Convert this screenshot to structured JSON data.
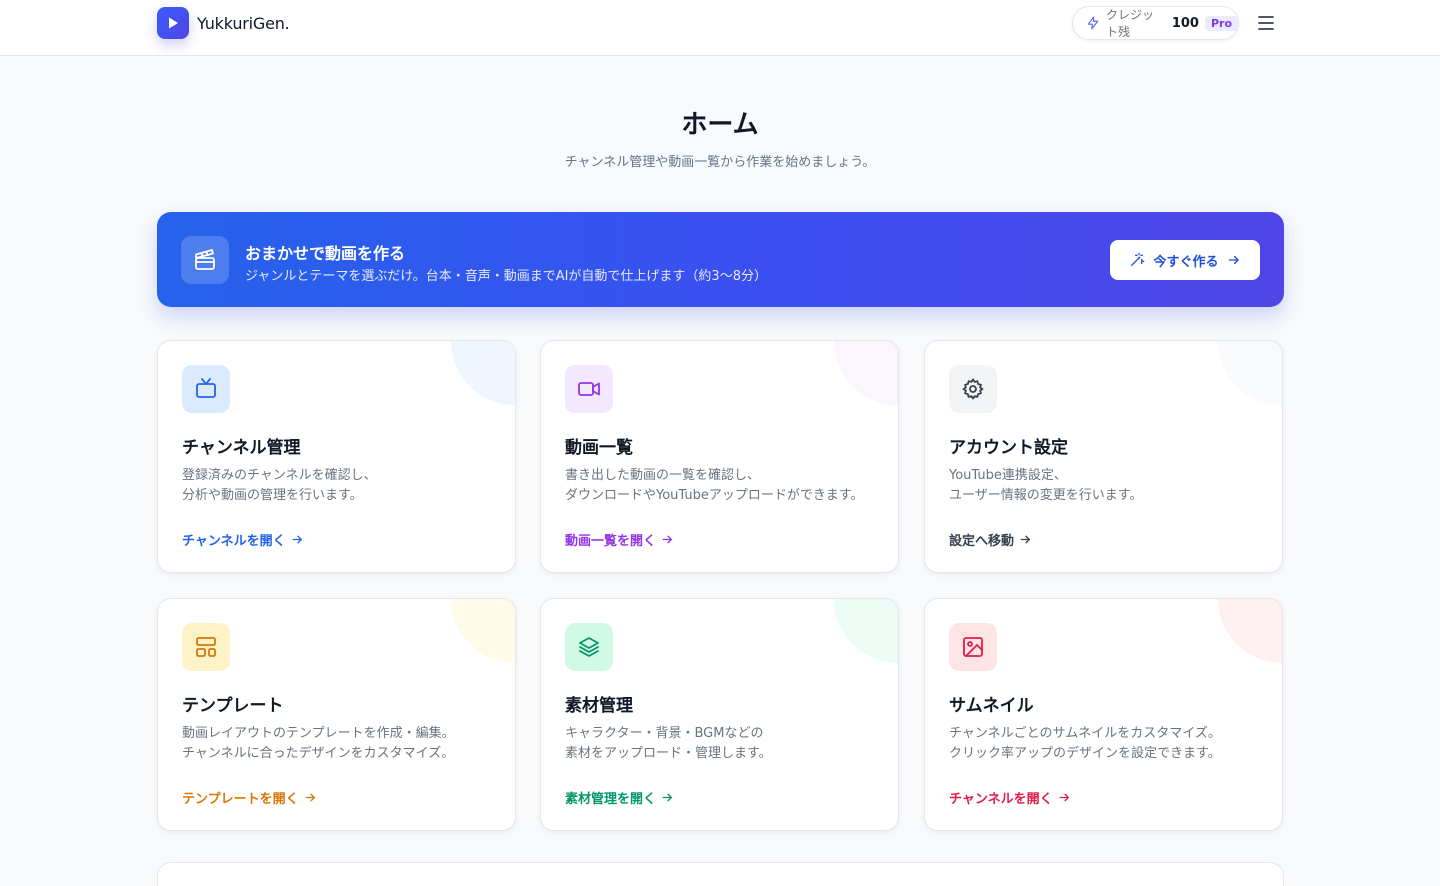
{
  "header": {
    "logo_text": "YukkuriGen.",
    "credit_label": "クレジット残",
    "credit_value": "100",
    "plan_badge": "Pro"
  },
  "page": {
    "title": "ホーム",
    "subtitle": "チャンネル管理や動画一覧から作業を始めましょう。"
  },
  "banner": {
    "title": "おまかせで動画を作る",
    "description": "ジャンルとテーマを選ぶだけ。台本・音声・動画までAIが自動で仕上げます（約3〜8分）",
    "button_label": "今すぐ作る"
  },
  "cards": [
    {
      "title": "チャンネル管理",
      "desc_line1": "登録済みのチャンネルを確認し、",
      "desc_line2": "分析や動画の管理を行います。",
      "link": "チャンネルを開く",
      "icon": "tv-icon",
      "accent": "#2563eb",
      "icon_bg": "#dbeafe",
      "deco": "#eff6ff"
    },
    {
      "title": "動画一覧",
      "desc_line1": "書き出した動画の一覧を確認し、",
      "desc_line2": "ダウンロードやYouTubeアップロードができます。",
      "link": "動画一覧を開く",
      "icon": "video-camera-icon",
      "accent": "#9333ea",
      "icon_bg": "#f3e8ff",
      "deco": "#faf5ff"
    },
    {
      "title": "アカウント設定",
      "desc_line1": "YouTube連携設定、",
      "desc_line2": "ユーザー情報の変更を行います。",
      "link": "設定へ移動",
      "icon": "gear-icon",
      "accent": "#374151",
      "icon_bg": "#f3f4f6",
      "deco": "#f9fafb"
    },
    {
      "title": "テンプレート",
      "desc_line1": "動画レイアウトのテンプレートを作成・編集。",
      "desc_line2": "チャンネルに合ったデザインをカスタマイズ。",
      "link": "テンプレートを開く",
      "icon": "layout-icon",
      "accent": "#d97706",
      "icon_bg": "#fef3c7",
      "deco": "#fefce8"
    },
    {
      "title": "素材管理",
      "desc_line1": "キャラクター・背景・BGMなどの",
      "desc_line2": "素材をアップロード・管理します。",
      "link": "素材管理を開く",
      "icon": "layers-icon",
      "accent": "#059669",
      "icon_bg": "#d1fae5",
      "deco": "#ecfdf5"
    },
    {
      "title": "サムネイル",
      "desc_line1": "チャンネルごとのサムネイルをカスタマイズ。",
      "desc_line2": "クリック率アップのデザインを設定できます。",
      "link": "チャンネルを開く",
      "icon": "image-icon",
      "accent": "#e11d48",
      "icon_bg": "#ffe4e6",
      "deco": "#fff1f2"
    }
  ]
}
